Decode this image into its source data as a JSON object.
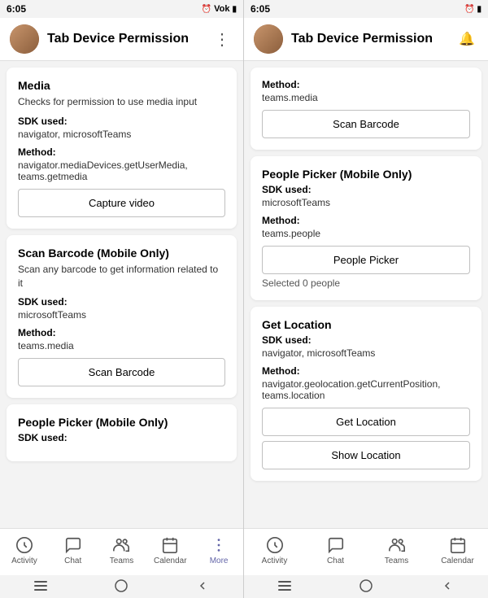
{
  "left_screen": {
    "status_bar": {
      "time": "6:05",
      "icons": "📶 🔋"
    },
    "header": {
      "title": "Tab Device Permission",
      "menu_icon": "⋮"
    },
    "cards": [
      {
        "id": "media",
        "title": "Media",
        "description": "Checks for permission to use media input",
        "sdk_label": "SDK used:",
        "sdk_value": "navigator, microsoftTeams",
        "method_label": "Method:",
        "method_value": "navigator.mediaDevices.getUserMedia, teams.getmedia",
        "button": "Capture video"
      },
      {
        "id": "scan-barcode",
        "title": "Scan Barcode (Mobile Only)",
        "description": "Scan any barcode to get information related to it",
        "sdk_label": "SDK used:",
        "sdk_value": "microsoftTeams",
        "method_label": "Method:",
        "method_value": "teams.media",
        "button": "Scan Barcode"
      },
      {
        "id": "people-picker",
        "title": "People Picker (Mobile Only)",
        "description": "",
        "sdk_label": "SDK used:",
        "sdk_value": ""
      }
    ],
    "nav": [
      {
        "id": "activity",
        "label": "Activity",
        "icon": "activity"
      },
      {
        "id": "chat",
        "label": "Chat",
        "icon": "chat"
      },
      {
        "id": "teams",
        "label": "Teams",
        "icon": "teams"
      },
      {
        "id": "calendar",
        "label": "Calendar",
        "icon": "calendar"
      },
      {
        "id": "more",
        "label": "More",
        "icon": "more",
        "active": true
      }
    ]
  },
  "right_screen": {
    "status_bar": {
      "time": "6:05",
      "icons": "🔔 🔋"
    },
    "header": {
      "title": "Tab Device Permission",
      "menu_icon": "🔔"
    },
    "sections": [
      {
        "id": "scan-barcode-top",
        "method_label": "Method:",
        "method_value": "teams.media",
        "button": "Scan Barcode"
      },
      {
        "id": "people-picker",
        "title": "People Picker (Mobile Only)",
        "sdk_label": "SDK used:",
        "sdk_value": "microsoftTeams",
        "method_label": "Method:",
        "method_value": "teams.people",
        "button": "People Picker",
        "selected": "Selected 0 people"
      },
      {
        "id": "get-location",
        "title": "Get Location",
        "sdk_label": "SDK used:",
        "sdk_value": "navigator, microsoftTeams",
        "method_label": "Method:",
        "method_value": "navigator.geolocation.getCurrentPosition, teams.location",
        "button1": "Get Location",
        "button2": "Show Location"
      }
    ],
    "nav": [
      {
        "id": "activity",
        "label": "Activity",
        "icon": "activity"
      },
      {
        "id": "chat",
        "label": "Chat",
        "icon": "chat"
      },
      {
        "id": "teams",
        "label": "Teams",
        "icon": "teams"
      },
      {
        "id": "calendar",
        "label": "Calendar",
        "icon": "calendar"
      }
    ]
  }
}
